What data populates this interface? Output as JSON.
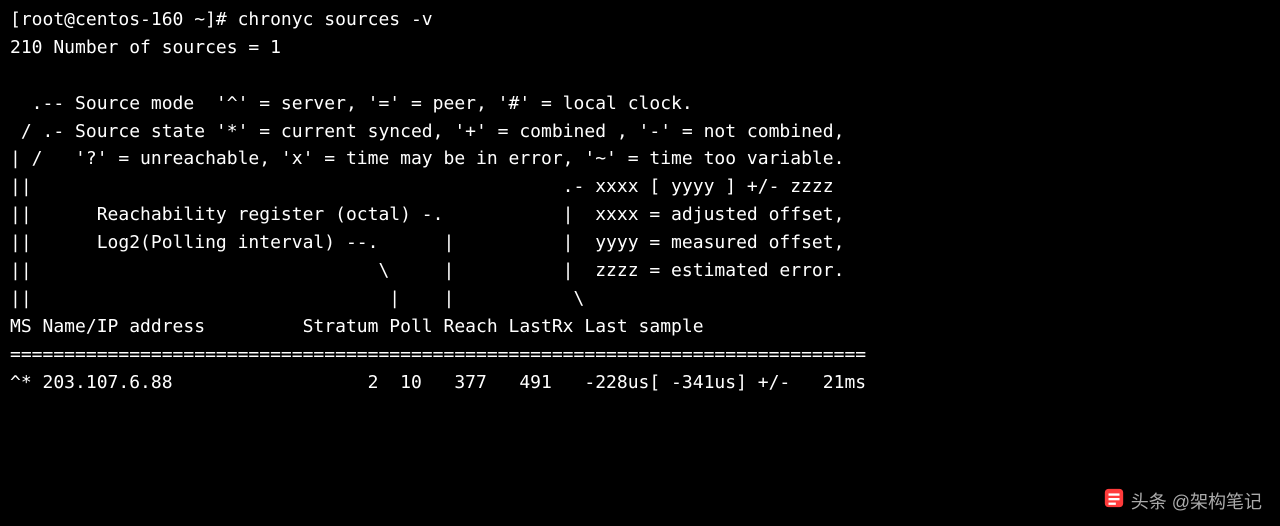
{
  "prompt": "[root@centos-160 ~]# ",
  "command": "chronyc sources -v",
  "sources_count_line": "210 Number of sources = 1",
  "legend": [
    "",
    "  .-- Source mode  '^' = server, '=' = peer, '#' = local clock.",
    " / .- Source state '*' = current synced, '+' = combined , '-' = not combined,",
    "| /   '?' = unreachable, 'x' = time may be in error, '~' = time too variable.",
    "||                                                 .- xxxx [ yyyy ] +/- zzzz",
    "||      Reachability register (octal) -.           |  xxxx = adjusted offset,",
    "||      Log2(Polling interval) --.      |          |  yyyy = measured offset,",
    "||                                \\     |          |  zzzz = estimated error.",
    "||                                 |    |           \\"
  ],
  "header": "MS Name/IP address         Stratum Poll Reach LastRx Last sample",
  "separator": "===============================================================================",
  "row": {
    "ms": "^*",
    "name": "203.107.6.88",
    "stratum": "2",
    "poll": "10",
    "reach": "377",
    "lastrx": "491",
    "last_sample": "-228us[ -341us] +/-   21ms"
  },
  "row_text": "^* 203.107.6.88                  2  10   377   491   -228us[ -341us] +/-   21ms",
  "watermark": "头条 @架构笔记"
}
